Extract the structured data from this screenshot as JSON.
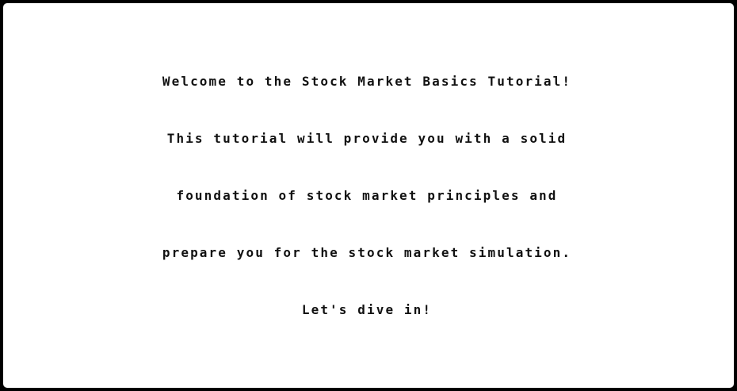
{
  "dialog": {
    "lines": [
      "Welcome to the Stock Market Basics Tutorial!",
      "This tutorial will provide you with a solid",
      "foundation of stock market principles and",
      "prepare you for the stock market simulation.",
      "Let's dive in!"
    ]
  }
}
